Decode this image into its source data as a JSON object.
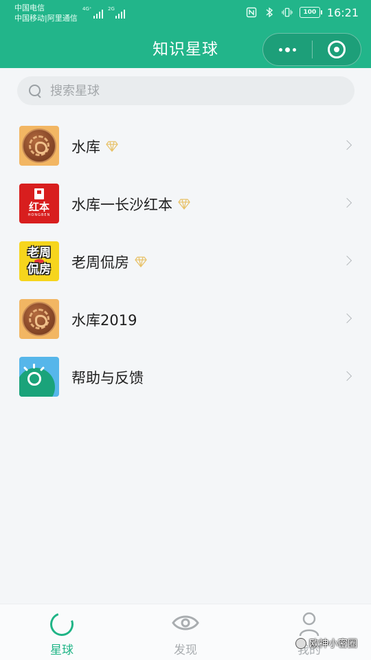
{
  "status_bar": {
    "carrier_1": "中国电信",
    "carrier_2": "中国移动|阿里通信",
    "net_1": "4G⁺",
    "net_2": "2G",
    "battery": "100",
    "time": "16:21"
  },
  "header": {
    "title": "知识星球"
  },
  "search": {
    "placeholder": "搜索星球"
  },
  "planets": [
    {
      "label": "水库",
      "avatar": "coin-dragon",
      "premium": true
    },
    {
      "label": "水库一长沙红本",
      "avatar": "red-book",
      "premium": true,
      "avatar_text": "红本",
      "avatar_subtext": "HONGBEN"
    },
    {
      "label": "老周侃房",
      "avatar": "yellow-text",
      "premium": true,
      "avatar_line1": "老周",
      "avatar_line2": "侃房"
    },
    {
      "label": "水库2019",
      "avatar": "coin-dragon",
      "premium": false
    },
    {
      "label": "帮助与反馈",
      "avatar": "help-bulb",
      "premium": false
    }
  ],
  "tabbar": {
    "tabs": [
      {
        "label": "星球",
        "active": true
      },
      {
        "label": "发现",
        "active": false
      },
      {
        "label": "我的",
        "active": false
      }
    ]
  },
  "watermark": {
    "text": "欧神小密圈"
  },
  "colors": {
    "brand_green": "#22b58a",
    "active_tab": "#1fb486",
    "inactive_tab": "#a9adb0",
    "gem": "#e8c26a"
  }
}
